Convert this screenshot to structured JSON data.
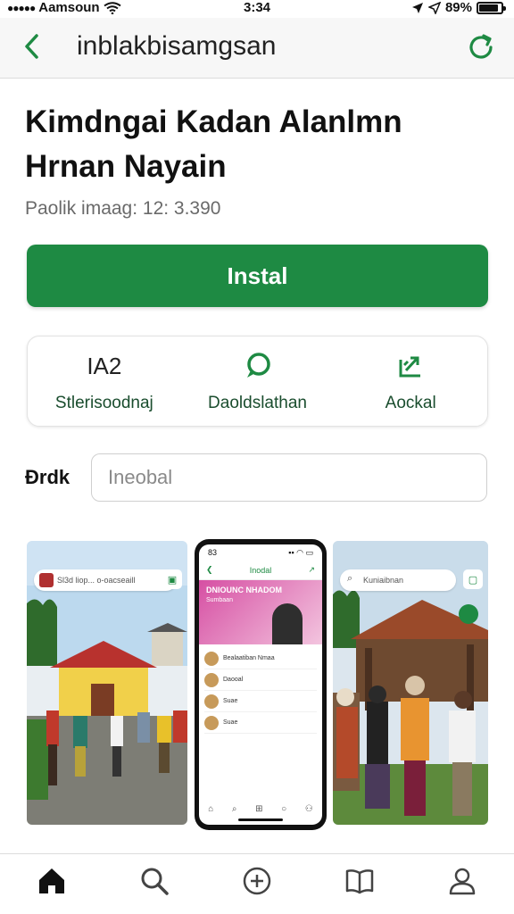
{
  "status_bar": {
    "carrier": "Aamsoun",
    "time": "3:34",
    "battery_text": "89%",
    "battery_level": 0.89
  },
  "nav": {
    "title": "inblakbisamgsan",
    "back_icon": "chevron-left-icon",
    "refresh_icon": "refresh-icon"
  },
  "app": {
    "title": "Kimdngai Kadan Alanlmn Hrnan Nayain",
    "meta": "Paolik imaag: 12: 3.390"
  },
  "install_label": "Instal",
  "actions": [
    {
      "icon_text": "IA2",
      "label": "Stlerisoodnaj"
    },
    {
      "icon": "chat-bubble-icon",
      "label": "Daoldslathan"
    },
    {
      "icon": "share-icon",
      "label": "Aockal"
    }
  ],
  "search": {
    "label": "Ðrdk",
    "placeholder": "Ineobal"
  },
  "screenshots": {
    "left": {
      "search_text": "Sl3d liop... o-oacseaill"
    },
    "phone": {
      "time": "83",
      "title": "Inodal",
      "hero_title": "DNIOUNC NHADOM",
      "hero_sub": "Sumbaan",
      "rows": [
        "Bealaatiban Nmaa",
        "Daooal",
        "Suae",
        "Suae"
      ]
    },
    "right": {
      "search_text": "Kuniaibnan"
    }
  },
  "colors": {
    "accent": "#1e8a43",
    "hero": "#d64fa3"
  },
  "tab_bar": [
    "home-icon",
    "search-icon",
    "add-icon",
    "book-icon",
    "profile-icon"
  ]
}
